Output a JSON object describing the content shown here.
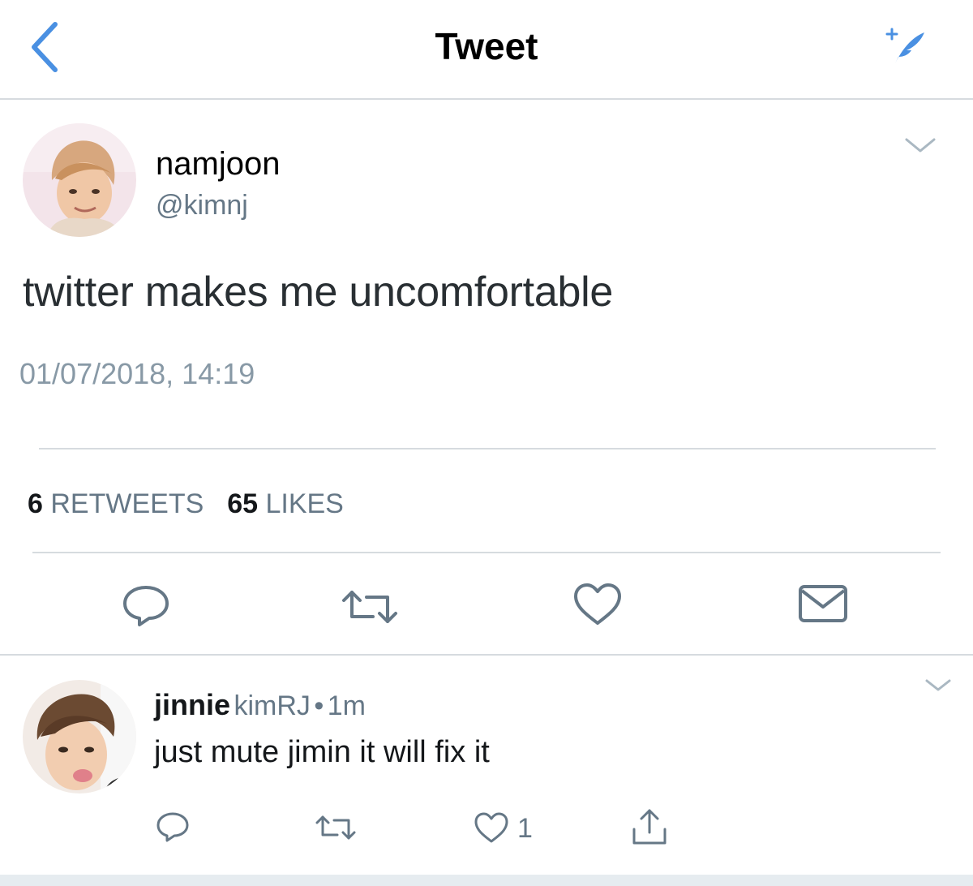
{
  "header": {
    "title": "Tweet",
    "back_icon": "chevron-left-icon",
    "compose_icon": "compose-feather-icon",
    "accent_color": "#4a90e2"
  },
  "tweet": {
    "name": "namjoon",
    "handle": "@kimnj",
    "text": "twitter makes me uncomfortable",
    "timestamp": "01/07/2018, 14:19",
    "retweets_count": "6",
    "retweets_label": "RETWEETS",
    "likes_count": "65",
    "likes_label": "LIKES",
    "actions": [
      "reply-icon",
      "retweet-icon",
      "like-icon",
      "message-icon"
    ]
  },
  "reply": {
    "name": "jinnie",
    "handle": "kimRJ",
    "separator": "•",
    "time": "1m",
    "text": "just mute jimin it will fix it",
    "like_count": "1",
    "actions": [
      "reply-icon",
      "retweet-icon",
      "like-icon",
      "share-icon"
    ]
  }
}
